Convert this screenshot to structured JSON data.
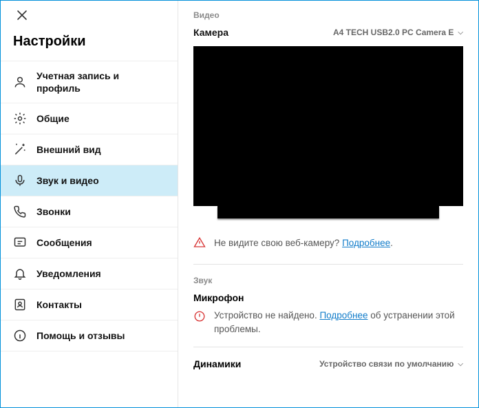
{
  "sidebar": {
    "title": "Настройки",
    "items": [
      {
        "label": "Учетная запись и профиль"
      },
      {
        "label": "Общие"
      },
      {
        "label": "Внешний вид"
      },
      {
        "label": "Звук и видео"
      },
      {
        "label": "Звонки"
      },
      {
        "label": "Сообщения"
      },
      {
        "label": "Уведомления"
      },
      {
        "label": "Контакты"
      },
      {
        "label": "Помощь и отзывы"
      }
    ]
  },
  "content": {
    "video_section_label": "Видео",
    "camera_label": "Камера",
    "camera_device": "A4 TECH USB2.0 PC Camera E",
    "camera_warning_text": "Не видите свою веб-камеру?",
    "camera_warning_link": "Подробнее",
    "camera_warning_period": ".",
    "audio_section_label": "Звук",
    "microphone_label": "Микрофон",
    "microphone_error_text1": "Устройство не найдено.",
    "microphone_error_link": "Подробнее",
    "microphone_error_text2": "об устранении этой проблемы.",
    "speakers_label": "Динамики",
    "speakers_device": "Устройство связи по умолчанию"
  }
}
